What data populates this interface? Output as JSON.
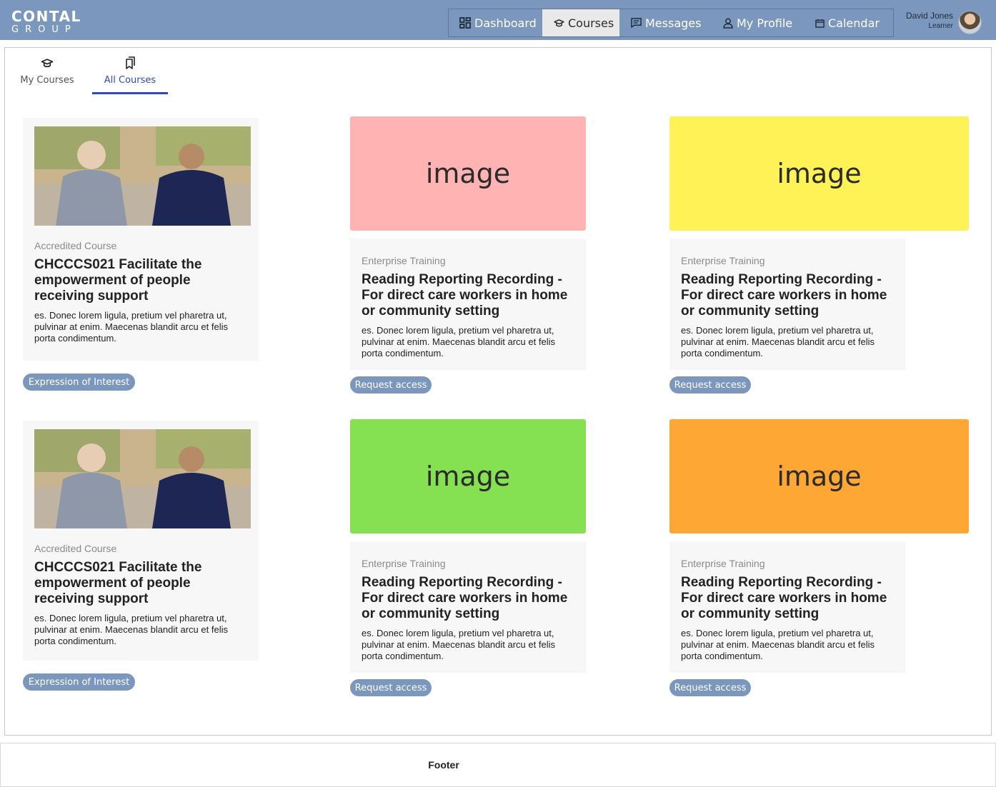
{
  "brand": {
    "line1": "CONTAL",
    "line2": "GROUP"
  },
  "nav": [
    {
      "label": "Dashboard",
      "icon": "dashboard-icon",
      "active": false
    },
    {
      "label": "Courses",
      "icon": "graduation-cap-icon",
      "active": true
    },
    {
      "label": "Messages",
      "icon": "message-icon",
      "active": false
    },
    {
      "label": "My Profile",
      "icon": "user-icon",
      "active": false
    },
    {
      "label": "Calendar",
      "icon": "calendar-icon",
      "active": false
    }
  ],
  "user": {
    "name": "David Jones",
    "role": "Learner"
  },
  "tabs": [
    {
      "label": "My Courses",
      "icon": "graduation-cap-icon",
      "active": false
    },
    {
      "label": "All Courses",
      "icon": "bookmarks-icon",
      "active": true
    }
  ],
  "courses": [
    {
      "type": "Accredited Course",
      "title": "CHCCCS021 Facilitate the empowerment of people receiving support",
      "description": "es. Donec lorem ligula, pretium vel pharetra ut, pulvinar at enim. Maecenas blandit arcu et felis porta condimentum.",
      "action": "Expression of Interest",
      "image": "photo"
    },
    {
      "type": "Enterprise Training",
      "title": "Reading Reporting Recording - For direct care workers in home or community setting",
      "description": "es. Donec lorem ligula, pretium vel pharetra ut, pulvinar at enim. Maecenas blandit arcu et felis porta condimentum.",
      "action": "Request access",
      "image": "image",
      "color": "#ffb3b3"
    },
    {
      "type": "Enterprise Training",
      "title": "Reading Reporting Recording - For direct care workers in home or community setting",
      "description": "es. Donec lorem ligula, pretium vel pharetra ut, pulvinar at enim. Maecenas blandit arcu et felis porta condimentum.",
      "action": "Request access",
      "image": "image",
      "color": "#fff256"
    },
    {
      "type": "Accredited Course",
      "title": "CHCCCS021 Facilitate the empowerment of people receiving support",
      "description": "es. Donec lorem ligula, pretium vel pharetra ut, pulvinar at enim. Maecenas blandit arcu et felis porta condimentum.",
      "action": "Expression of Interest",
      "image": "photo"
    },
    {
      "type": "Enterprise Training",
      "title": "Reading Reporting Recording - For direct care workers in home or community setting",
      "description": "es. Donec lorem ligula, pretium vel pharetra ut, pulvinar at enim. Maecenas blandit arcu et felis porta condimentum.",
      "action": "Request access",
      "image": "image",
      "color": "#85e052"
    },
    {
      "type": "Enterprise Training",
      "title": "Reading Reporting Recording - For direct care workers in home or community setting",
      "description": "es. Donec lorem ligula, pretium vel pharetra ut, pulvinar at enim. Maecenas blandit arcu et felis porta condimentum.",
      "action": "Request access",
      "image": "image",
      "color": "#ffa735"
    }
  ],
  "footer": {
    "text": "Footer"
  }
}
